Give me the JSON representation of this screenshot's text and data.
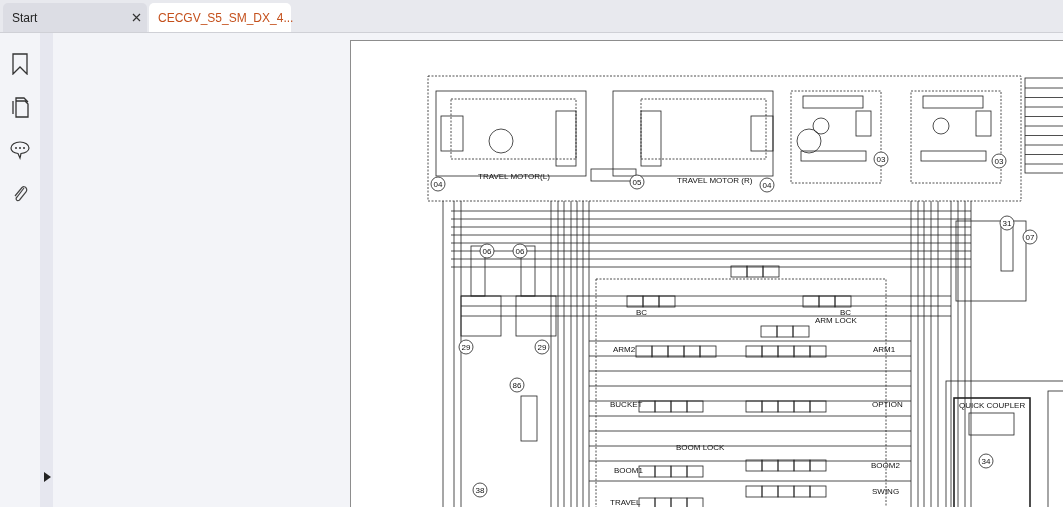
{
  "tabs": [
    {
      "label": "Start",
      "selected": false
    },
    {
      "label": "CECGV_S5_SM_DX_4...",
      "selected": true
    }
  ],
  "schematic": {
    "motor_labels": [
      "TRAVEL MOTOR(L)",
      "TRAVEL MOTOR (R)"
    ],
    "callouts": [
      "04",
      "05",
      "04",
      "03",
      "03",
      "31",
      "07",
      "06",
      "06",
      "29",
      "29",
      "86",
      "34",
      "38"
    ],
    "valve_labels": [
      "BC",
      "BC",
      "ARM LOCK",
      "ARM2",
      "ARM1",
      "BUCKET",
      "OPTION",
      "BOOM LOCK",
      "BOOM1",
      "BOOM2",
      "SWING",
      "TRAVEL"
    ],
    "coupler_title": "QUICK COUPLER"
  }
}
